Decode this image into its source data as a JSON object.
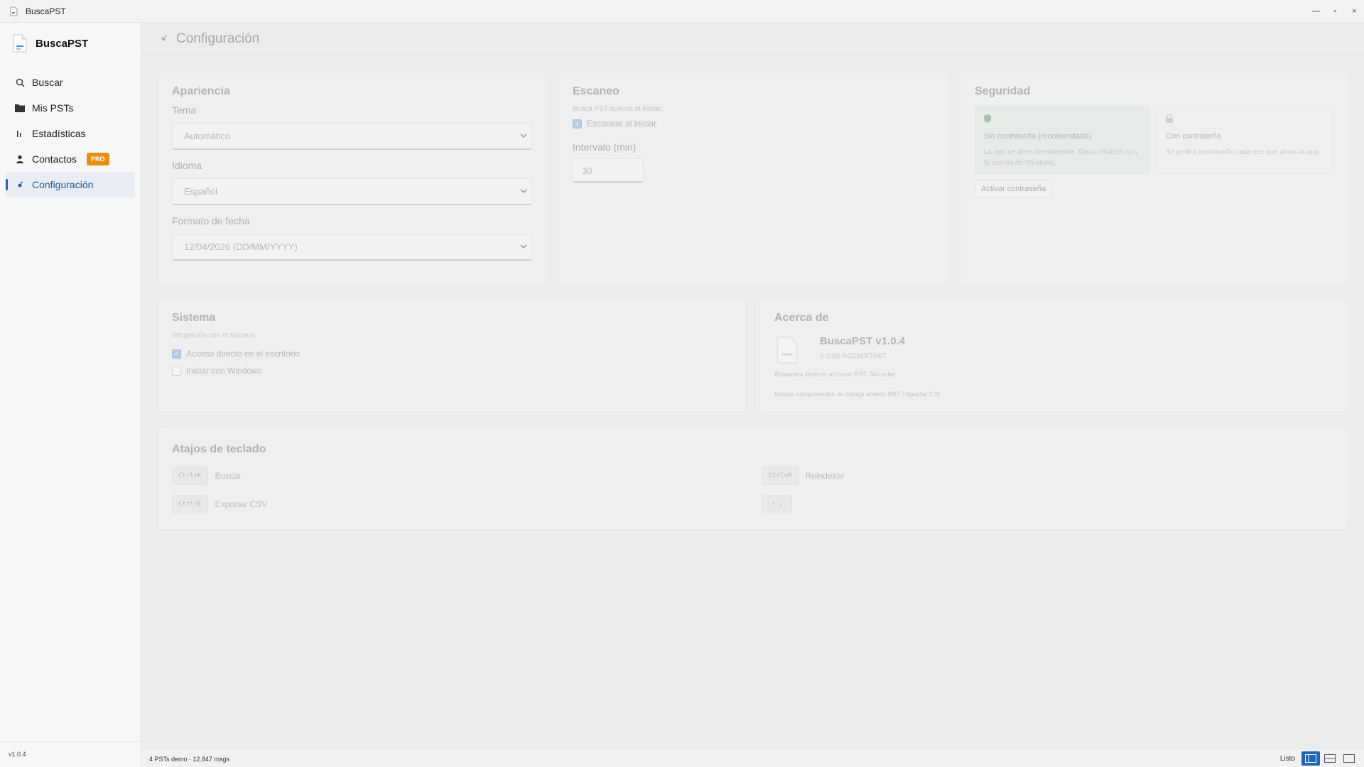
{
  "window": {
    "title": "BuscaPST",
    "controls": {
      "minimize": "—",
      "maximize": "▫",
      "close": "×"
    }
  },
  "sidebar": {
    "brand": "BuscaPST",
    "items": [
      {
        "label": "Buscar",
        "icon": "search-icon"
      },
      {
        "label": "Mis PSTs",
        "icon": "folder-icon"
      },
      {
        "label": "Estadísticas",
        "icon": "bar-chart-icon"
      },
      {
        "label": "Contactos",
        "icon": "person-icon",
        "badge": "PRO"
      },
      {
        "label": "Configuración",
        "icon": "gear-icon",
        "active": true
      }
    ],
    "version": "v1.0.4"
  },
  "page": {
    "title": "Configuración"
  },
  "appearance": {
    "title": "Apariencia",
    "theme_label": "Tema",
    "theme_value": "Automático",
    "language_label": "Idioma",
    "language_value": "Español",
    "date_format_label": "Formato de fecha",
    "date_format_value": "12/04/2026 (DD/MM/YYYY)"
  },
  "scan": {
    "title": "Escaneo",
    "subtitle": "Busca PST nuevos al iniciar.",
    "scan_on_start_label": "Escanear al iniciar",
    "scan_on_start_checked": true,
    "interval_label": "Intervalo (min)",
    "interval_value": "30"
  },
  "security": {
    "title": "Seguridad",
    "option_no_password_title": "Sin contraseña (recomendado)",
    "option_no_password_desc": "La app se abre directamente. Datos cifrados con tu cuenta de Windows.",
    "option_password_title": "Con contraseña",
    "option_password_desc": "Se pedirá contraseña cada vez que abras la app.",
    "activate_button": "Activar contraseña"
  },
  "system": {
    "title": "Sistema",
    "subtitle": "Integración con el sistema.",
    "desktop_shortcut_label": "Acceso directo en el escritorio",
    "desktop_shortcut_checked": true,
    "start_with_windows_label": "Iniciar con Windows",
    "start_with_windows_checked": false
  },
  "about": {
    "title": "Acerca de",
    "app_version": "BuscaPST v1.0.4",
    "copyright": "© 2026 RGCSOFTNET",
    "description": "Búsqueda local en archivos PST. Sin nube.",
    "licenses": "Incluye componentes de código abierto (MIT / Apache 2.0)."
  },
  "shortcuts": {
    "title": "Atajos de teclado",
    "items": [
      {
        "keys": "Ctrl+K",
        "action": "Buscar"
      },
      {
        "keys": "Ctrl+R",
        "action": "Reindexar"
      },
      {
        "keys": "Ctrl+E",
        "action": "Exportar CSV"
      },
      {
        "keys": "↑ ↓",
        "action": ""
      }
    ]
  },
  "statusbar": {
    "left": "4 PSTs demo · 12.847 msgs",
    "ready": "Listo"
  },
  "colors": {
    "accent": "#1f65b8",
    "pro_badge": "#e88f12"
  }
}
